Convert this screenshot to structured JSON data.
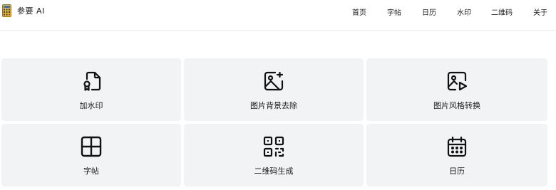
{
  "brand": {
    "name": "参要 AI",
    "logo_icon": "calculator-logo-icon"
  },
  "nav": {
    "items": [
      {
        "label": "首页",
        "id": "home"
      },
      {
        "label": "字帖",
        "id": "copybook"
      },
      {
        "label": "日历",
        "id": "calendar"
      },
      {
        "label": "水印",
        "id": "watermark"
      },
      {
        "label": "二维码",
        "id": "qrcode"
      },
      {
        "label": "关于",
        "id": "about"
      }
    ]
  },
  "tools": {
    "items": [
      {
        "label": "加水印",
        "icon": "file-certificate-icon"
      },
      {
        "label": "图片背景去除",
        "icon": "image-edit-icon"
      },
      {
        "label": "图片风格转换",
        "icon": "image-play-icon"
      },
      {
        "label": "字帖",
        "icon": "grid-icon"
      },
      {
        "label": "二维码生成",
        "icon": "qr-code-icon"
      },
      {
        "label": "日历",
        "icon": "calendar-icon"
      }
    ]
  },
  "colors": {
    "card_background": "#f2f3f5",
    "text": "#1b1b1b",
    "logo_yellow": "#e8b92d"
  }
}
